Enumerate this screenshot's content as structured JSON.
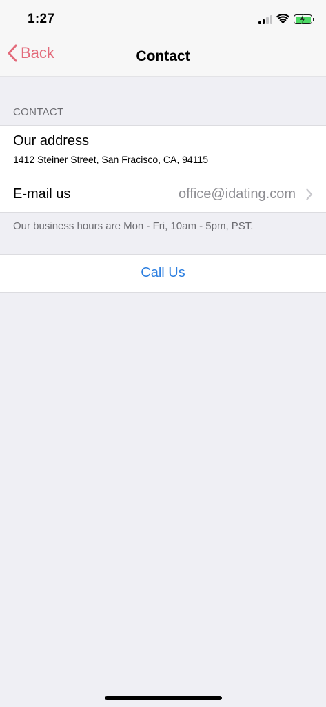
{
  "status_bar": {
    "time": "1:27",
    "icons": [
      "cellular-signal-icon",
      "wifi-icon",
      "battery-charging-icon"
    ]
  },
  "nav": {
    "back_label": "Back",
    "title": "Contact",
    "accent_color": "#e36a7a"
  },
  "section": {
    "header": "CONTACT",
    "address": {
      "title": "Our address",
      "value": "1412 Steiner Street, San Fracisco, CA, 94115"
    },
    "email": {
      "title": "E-mail us",
      "value": "office@idating.com"
    },
    "footer": "Our business hours are Mon - Fri, 10am - 5pm, PST."
  },
  "call": {
    "label": "Call Us",
    "color": "#2d7fe0"
  }
}
